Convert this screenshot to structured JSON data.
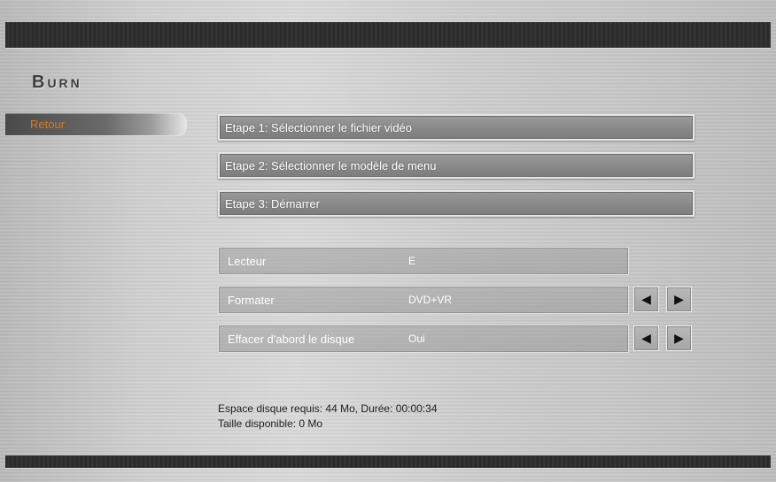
{
  "app": {
    "logo": "Burn"
  },
  "nav": {
    "back_label": "Retour"
  },
  "steps": [
    {
      "label": "Etape 1: Sélectionner le fichier vidéo"
    },
    {
      "label": "Etape 2: Sélectionner le modèle de menu"
    },
    {
      "label": "Etape 3: Démarrer"
    }
  ],
  "options": [
    {
      "label": "Lecteur",
      "value": "E"
    },
    {
      "label": "Formater",
      "value": "DVD+VR"
    },
    {
      "label": "Effacer d'abord le disque",
      "value": "Oui"
    }
  ],
  "icons": {
    "prev": "left-arrow-icon",
    "next": "right-arrow-icon"
  },
  "info": {
    "required_space": "Espace disque requis: 44 Mo, Durée: 00:00:34",
    "available_space": "Taille disponible: 0 Mo"
  },
  "colors": {
    "accent": "#e07a16",
    "frame_dark": "#2b2b2b",
    "button_text": "#ffffff"
  }
}
